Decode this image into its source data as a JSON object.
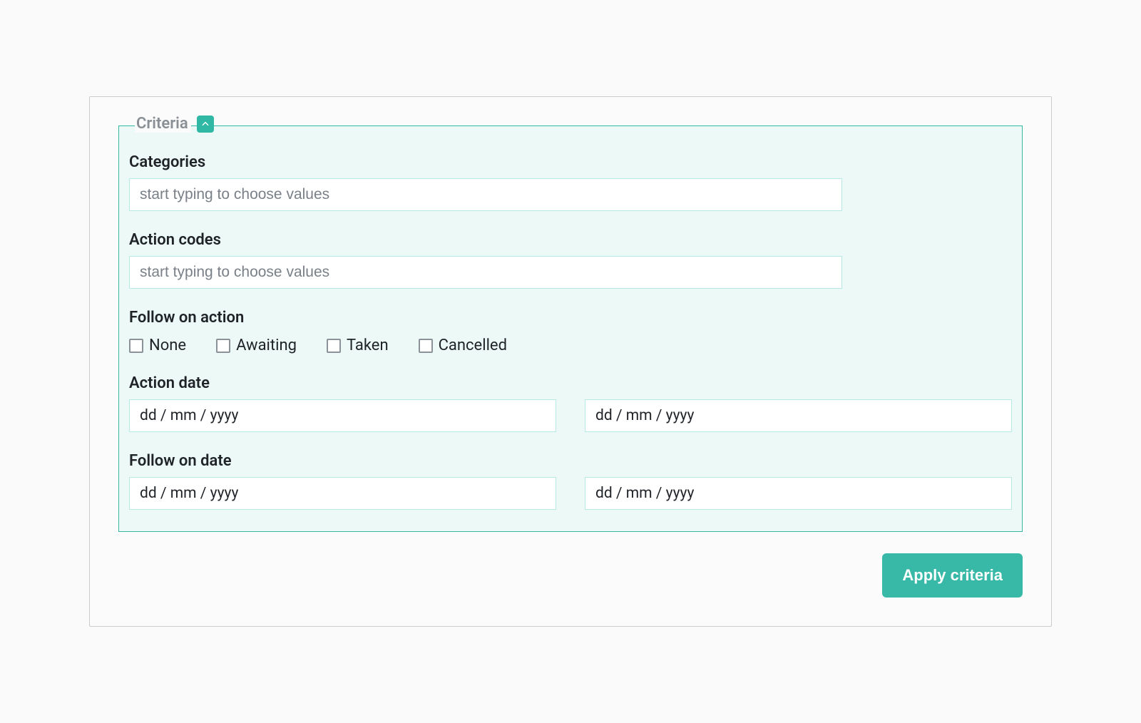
{
  "criteria": {
    "legend": "Criteria",
    "categories": {
      "label": "Categories",
      "placeholder": "start typing to choose values",
      "value": ""
    },
    "action_codes": {
      "label": "Action codes",
      "placeholder": "start typing to choose values",
      "value": ""
    },
    "follow_on_action": {
      "label": "Follow on action",
      "options": [
        {
          "label": "None",
          "checked": false
        },
        {
          "label": "Awaiting",
          "checked": false
        },
        {
          "label": "Taken",
          "checked": false
        },
        {
          "label": "Cancelled",
          "checked": false
        }
      ]
    },
    "action_date": {
      "label": "Action date",
      "from_placeholder": "dd / mm / yyyy",
      "to_placeholder": "dd / mm / yyyy"
    },
    "follow_on_date": {
      "label": "Follow on date",
      "from_placeholder": "dd / mm / yyyy",
      "to_placeholder": "dd / mm / yyyy"
    }
  },
  "buttons": {
    "apply": "Apply criteria"
  },
  "colors": {
    "accent": "#34b8a6",
    "panel_bg": "#ecf9f7",
    "input_border": "#b6e9e1",
    "checkbox_border": "#8c9299",
    "legend_text": "#8a8f96"
  }
}
